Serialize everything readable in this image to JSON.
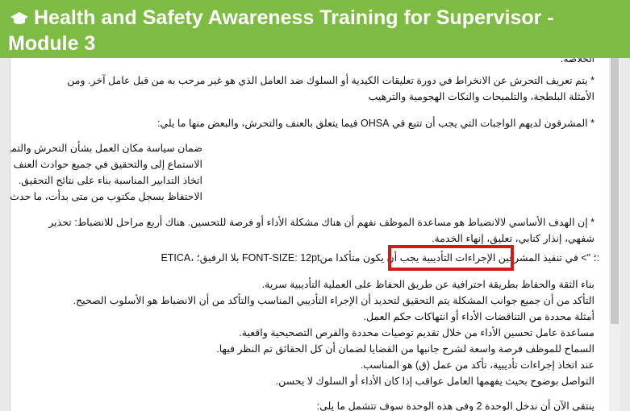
{
  "header": {
    "title": "Health and Safety Awareness Training for Supervisor - Module 3",
    "icon": "graduation-cap-icon",
    "bg_color": "#7dbb43"
  },
  "content": {
    "cropped_top": "الخلاصة:",
    "p1_line1": "* يتم تعريف التحرش عن الانخراط في دورة تعليقات الكيدية أو السلوك ضد العامل الذي هو غير مرحب به من قبل عامل آخر. ومن",
    "p1_line2": "الأمثلة البلطجة، والتلميحات والنكات الهجومية والترهيب",
    "p2": "* المشرفون لديهم الواجبات التي يجب أن تتبع في OHSA فيما يتعلق بالعنف والتحرش، والبعض منها ما يلي:",
    "list1": [
      "ضمان سياسة مكان العمل بشأن التحرش والتمييز والعنف وإبلاغ وفهمها من قبل جميع العاملين.",
      "الاستماع إلى والتحقيق في جميع حوادث العنف في مكان العمل باستخدام جميع الوسائل المتاحة.",
      "اتخاذ التدابير المناسبة بناء على نتائج التحقيق.",
      "الاحتفاظ بسجل مكتوب من متى بدأت، ما حدث، والذي شارك ومتى وأين حدث ذلك، نتيجة وأي إجراءات تأديبية اتخذت."
    ],
    "p3_line1": "* إن الهدف الأساسي لالانضباط هو مساعدة الموظف نفهم أن هناك مشكلة الأداء أو فرصة للتحسين. هناك أربع مراحل للانضباط: تحذير",
    "p3_line2": "شفهي، إنذار كتابي، تعليق، إنهاء الخدمة.",
    "etica_line": "ETICA، بلا الرفيق؛ FONT-SIZE: 12pt؛ \"> في تنفيذ المشرفين الإجراءات التأديبية يجب أن يكون متأكدا من:",
    "list2": [
      "بناء الثقة والحفاظ بطريقة احترافية عن طريق الحفاظ على العملية التأديبية سرية.",
      "التأكد من أن جميع جوانب المشكلة يتم التحقيق لتحديد أن الإجراء التأديبي المناسب والتأكد من أن الانضباط هو الأسلوب الصحيح.",
      "أمثلة محددة من التناقضات الأداء أو انتهاكات حكم العمل.",
      "مساعدة عامل تحسين الأداء من خلال تقديم توصيات محددة والفرص التصحيحية واقعية.",
      "السماح للموظف فرصة واسعة لشرح جانبها من القضايا لضمان أن كل الحقائق تم النظر فيها.",
      "عند اتخاذ إجراءات تأديبية، تأكد من عمل (ق) هو المناسب.",
      "التواصل بوضوح بحيث يفهمها العامل عواقب إذا كان الأداء أو السلوك لا يحسن."
    ],
    "cropped_bottom": "ينتقي الآن أن ندخل الوحدة 2 وفي هذه الوحدة سوف تتشمل ما يلي:"
  },
  "colors": {
    "highlight_border": "#d61a1a"
  }
}
